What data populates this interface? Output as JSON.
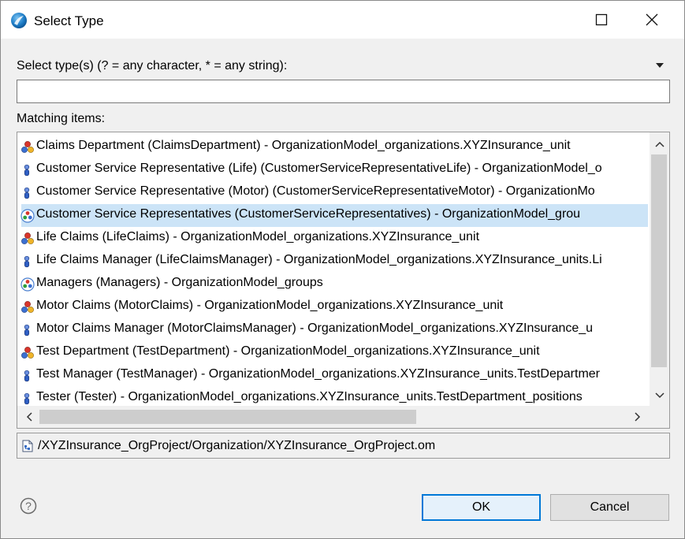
{
  "window": {
    "title": "Select Type"
  },
  "filter": {
    "label": "Select type(s) (? = any character, * = any string):",
    "value": ""
  },
  "matching": {
    "label": "Matching items:",
    "items": [
      {
        "text": "Claims Department (ClaimsDepartment) - OrganizationModel_organizations.XYZInsurance_unit",
        "icon": "org-unit-icon",
        "selected": false
      },
      {
        "text": "Customer Service Representative (Life) (CustomerServiceRepresentativeLife) - OrganizationModel_o",
        "icon": "position-icon",
        "selected": false
      },
      {
        "text": "Customer Service Representative (Motor) (CustomerServiceRepresentativeMotor) - OrganizationMo",
        "icon": "position-icon",
        "selected": false
      },
      {
        "text": "Customer Service Representatives (CustomerServiceRepresentatives) - OrganizationModel_grou",
        "icon": "group-icon",
        "selected": true
      },
      {
        "text": "Life Claims (LifeClaims) - OrganizationModel_organizations.XYZInsurance_unit",
        "icon": "org-unit-icon",
        "selected": false
      },
      {
        "text": "Life Claims Manager (LifeClaimsManager) - OrganizationModel_organizations.XYZInsurance_units.Li",
        "icon": "position-icon",
        "selected": false
      },
      {
        "text": "Managers (Managers) - OrganizationModel_groups",
        "icon": "group-icon",
        "selected": false
      },
      {
        "text": "Motor Claims (MotorClaims) - OrganizationModel_organizations.XYZInsurance_unit",
        "icon": "org-unit-icon",
        "selected": false
      },
      {
        "text": "Motor Claims Manager (MotorClaimsManager) - OrganizationModel_organizations.XYZInsurance_u",
        "icon": "position-icon",
        "selected": false
      },
      {
        "text": "Test Department (TestDepartment) - OrganizationModel_organizations.XYZInsurance_unit",
        "icon": "org-unit-icon",
        "selected": false
      },
      {
        "text": "Test Manager (TestManager) - OrganizationModel_organizations.XYZInsurance_units.TestDepartmer",
        "icon": "position-icon",
        "selected": false
      },
      {
        "text": "Tester (Tester) - OrganizationModel_organizations.XYZInsurance_units.TestDepartment_positions",
        "icon": "position-icon",
        "selected": false
      }
    ]
  },
  "path": {
    "text": "/XYZInsurance_OrgProject/Organization/XYZInsurance_OrgProject.om",
    "icon": "om-file-icon"
  },
  "buttons": {
    "ok": "OK",
    "cancel": "Cancel"
  },
  "colors": {
    "selection": "#cce4f7",
    "default_button_border": "#0078d7"
  }
}
